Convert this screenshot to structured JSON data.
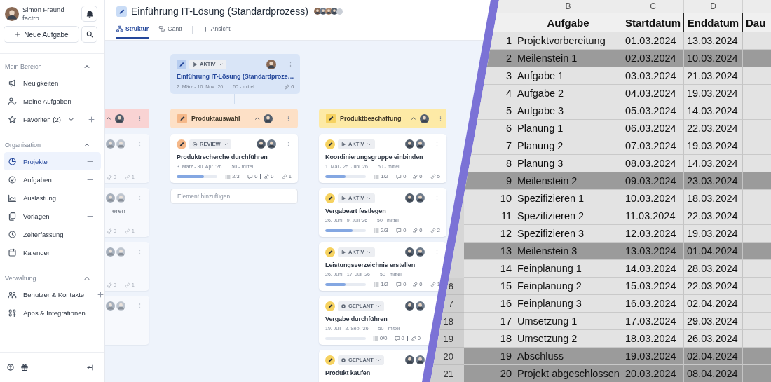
{
  "sidebar": {
    "user": {
      "name": "Simon Freund",
      "company": "factro"
    },
    "new_task_button": "Neue Aufgabe",
    "sections": [
      {
        "title": "Mein Bereich",
        "expanded": true,
        "items": [
          {
            "label": "Neuigkeiten",
            "selected": false,
            "add_button": false,
            "dropdown": false
          },
          {
            "label": "Meine Aufgaben",
            "selected": false,
            "add_button": false,
            "dropdown": false
          },
          {
            "label": "Favoriten (2)",
            "selected": false,
            "add_button": true,
            "dropdown": true
          }
        ]
      },
      {
        "title": "Organisation",
        "expanded": true,
        "items": [
          {
            "label": "Projekte",
            "selected": true,
            "add_button": true,
            "dropdown": false
          },
          {
            "label": "Aufgaben",
            "selected": false,
            "add_button": true,
            "dropdown": false
          },
          {
            "label": "Auslastung",
            "selected": false,
            "add_button": false,
            "dropdown": false
          },
          {
            "label": "Vorlagen",
            "selected": false,
            "add_button": true,
            "dropdown": false
          },
          {
            "label": "Zeiterfassung",
            "selected": false,
            "add_button": false,
            "dropdown": false
          },
          {
            "label": "Kalender",
            "selected": false,
            "add_button": false,
            "dropdown": false
          }
        ]
      },
      {
        "title": "Verwaltung",
        "expanded": true,
        "items": [
          {
            "label": "Benutzer & Kontakte",
            "selected": false,
            "add_button": true,
            "dropdown": false
          },
          {
            "label": "Apps & Integrationen",
            "selected": false,
            "add_button": false,
            "dropdown": false
          }
        ]
      }
    ]
  },
  "project": {
    "title": "Einführung IT-Lösung (Standardprozess)",
    "tabs": [
      {
        "label": "Struktur",
        "selected": true
      },
      {
        "label": "Gantt",
        "selected": false
      }
    ],
    "add_view_button": "Ansicht"
  },
  "board": {
    "root": {
      "status": {
        "label": "AKTIV",
        "kind": "active"
      },
      "title": "Einführung IT-Lösung (Standardproze…",
      "dates": "2. März - 10. Nov. '26",
      "priority": "50 - mittel",
      "links": "0"
    },
    "columns": [
      {
        "color": "#f9d3d3",
        "expanded": true,
        "cards": [
          {
            "kind": "partial",
            "attachments": "0",
            "links": "1"
          },
          {
            "kind": "partial",
            "title": "eren",
            "attachments": "0",
            "links": "1"
          },
          {
            "kind": "partial",
            "attachments": "0",
            "links": "1"
          },
          {
            "kind": "partial"
          }
        ]
      },
      {
        "title": "Produktauswahl",
        "color": "#fde0c6",
        "expanded": true,
        "cards": [
          {
            "kind": "full",
            "status": {
              "label": "REVIEW",
              "kind": "review"
            },
            "title": "Produktrecherche durchführen",
            "dates": "3. März - 30. Apr. '26",
            "priority": "50 - mittel",
            "level": 0.67,
            "checklist": "2/3",
            "comments": "0",
            "attachments": "0",
            "links": "1"
          }
        ],
        "add_placeholder": "Element hinzufügen"
      },
      {
        "title": "Produktbeschaffung",
        "color": "#fdeaa6",
        "expanded": true,
        "cards": [
          {
            "kind": "full",
            "status": {
              "label": "AKTIV",
              "kind": "active"
            },
            "title": "Koordinierungsgruppe einbinden",
            "dates": "1. Mai - 25. Juni '26",
            "priority": "50 - mittel",
            "level": 0.5,
            "checklist": "1/2",
            "comments": "0",
            "attachments": "0",
            "links": "5"
          },
          {
            "kind": "full",
            "status": {
              "label": "AKTIV",
              "kind": "active"
            },
            "title": "Vergabeart festlegen",
            "dates": "26. Juni - 9. Juli '26",
            "priority": "50 - mittel",
            "level": 0.67,
            "checklist": "2/3",
            "comments": "0",
            "attachments": "0",
            "links": "2"
          },
          {
            "kind": "full",
            "status": {
              "label": "AKTIV",
              "kind": "active"
            },
            "title": "Leistungsverzeichnis erstellen",
            "dates": "26. Juni - 17. Juli '26",
            "priority": "50 - mittel",
            "level": 0.5,
            "checklist": "1/2",
            "comments": "0",
            "attachments": "0",
            "links": "1"
          },
          {
            "kind": "full",
            "status": {
              "label": "GEPLANT",
              "kind": "planned"
            },
            "title": "Vergabe durchführen",
            "dates": "19. Juli - 2. Sep. '26",
            "priority": "50 - mittel",
            "checklist": "0/0",
            "comments": "0",
            "attachments": "0"
          },
          {
            "kind": "full",
            "status": {
              "label": "GEPLANT",
              "kind": "planned"
            },
            "title": "Produkt kaufen"
          }
        ]
      }
    ]
  },
  "sheet": {
    "column_letters": [
      "B",
      "C",
      "D"
    ],
    "headers": [
      "Aufgabe",
      "Startdatum",
      "Enddatum",
      "Dau"
    ],
    "rows": [
      {
        "number": "1",
        "task": "Projektvorbereitung",
        "start": "01.03.2024",
        "end": "13.03.2024",
        "highlighted": false
      },
      {
        "number": "2",
        "task": "Meilenstein 1",
        "start": "02.03.2024",
        "end": "10.03.2024",
        "highlighted": true
      },
      {
        "number": "3",
        "task": "Aufgabe 1",
        "start": "03.03.2024",
        "end": "21.03.2024",
        "highlighted": false
      },
      {
        "number": "4",
        "task": "Aufgabe 2",
        "start": "04.03.2024",
        "end": "19.03.2024",
        "highlighted": false
      },
      {
        "number": "5",
        "task": "Aufgabe 3",
        "start": "05.03.2024",
        "end": "14.03.2024",
        "highlighted": false
      },
      {
        "number": "6",
        "task": "Planung 1",
        "start": "06.03.2024",
        "end": "22.03.2024",
        "highlighted": false
      },
      {
        "number": "7",
        "task": "Planung 2",
        "start": "07.03.2024",
        "end": "19.03.2024",
        "highlighted": false
      },
      {
        "number": "8",
        "task": "Planung 3",
        "start": "08.03.2024",
        "end": "14.03.2024",
        "highlighted": false
      },
      {
        "number": "9",
        "task": "Meilenstein 2",
        "start": "09.03.2024",
        "end": "23.03.2024",
        "highlighted": true
      },
      {
        "number": "10",
        "task": "Spezifizieren 1",
        "start": "10.03.2024",
        "end": "18.03.2024",
        "highlighted": false
      },
      {
        "number": "11",
        "task": "Spezifizieren 2",
        "start": "11.03.2024",
        "end": "22.03.2024",
        "highlighted": false
      },
      {
        "number": "12",
        "task": "Spezifizieren 3",
        "start": "12.03.2024",
        "end": "19.03.2024",
        "highlighted": false
      },
      {
        "number": "13",
        "task": "Meilenstein 3",
        "start": "13.03.2024",
        "end": "01.04.2024",
        "highlighted": true
      },
      {
        "number": "14",
        "task": "Feinplanung 1",
        "start": "14.03.2024",
        "end": "28.03.2024",
        "highlighted": false
      },
      {
        "row_header": "6",
        "number": "15",
        "task": "Feinplanung 2",
        "start": "15.03.2024",
        "end": "22.03.2024",
        "highlighted": false
      },
      {
        "row_header": "7",
        "number": "16",
        "task": "Feinplanung 3",
        "start": "16.03.2024",
        "end": "02.04.2024",
        "highlighted": false
      },
      {
        "row_header": "18",
        "number": "17",
        "task": "Umsetzung 1",
        "start": "17.03.2024",
        "end": "29.03.2024",
        "highlighted": false
      },
      {
        "row_header": "19",
        "number": "18",
        "task": "Umsetzung 2",
        "start": "18.03.2024",
        "end": "26.03.2024",
        "highlighted": false
      },
      {
        "row_header": "20",
        "number": "19",
        "task": "Abschluss",
        "start": "19.03.2024",
        "end": "02.04.2024",
        "highlighted": true
      },
      {
        "row_header": "21",
        "number": "20",
        "task": "Projekt abgeschlossen",
        "start": "20.03.2024",
        "end": "08.04.2024",
        "highlighted": true
      }
    ]
  }
}
